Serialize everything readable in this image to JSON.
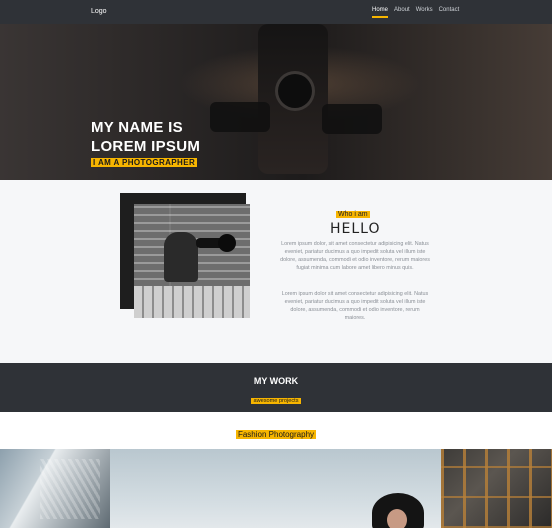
{
  "navbar": {
    "logo": "Logo",
    "links": [
      {
        "label": "Home",
        "active": true
      },
      {
        "label": "About",
        "active": false
      },
      {
        "label": "Works",
        "active": false
      },
      {
        "label": "Contact",
        "active": false
      }
    ]
  },
  "hero": {
    "title_line1": "MY NAME IS",
    "title_line2": "LOREM IPSUM",
    "subtitle": "I AM A PHOTOGRAPHER"
  },
  "about": {
    "label": "Who i am",
    "heading": "HELLO",
    "paragraph1": "Lorem ipsum dolor, sit amet consectetur adipisicing elit. Natus eveniet, pariatur ducimus a quo impedit soluta vel illum iste dolore, assumenda, commodi et odio inventore, rerum maiores fugiat minima cum labore amet libero minus quis.",
    "paragraph2": "Lorem ipsum dolor sit amet consectetur adipisicing elit. Natus eveniet, pariatur ducimus a quo impedit soluta vel illum iste dolore, assumenda, commodi et odio inventore, rerum maiores."
  },
  "work": {
    "title": "MY WORK",
    "subtitle": "awesome projects"
  },
  "fashion": {
    "title": "Fashion Photography"
  },
  "colors": {
    "accent": "#f7b500",
    "dark": "#2f3237"
  }
}
